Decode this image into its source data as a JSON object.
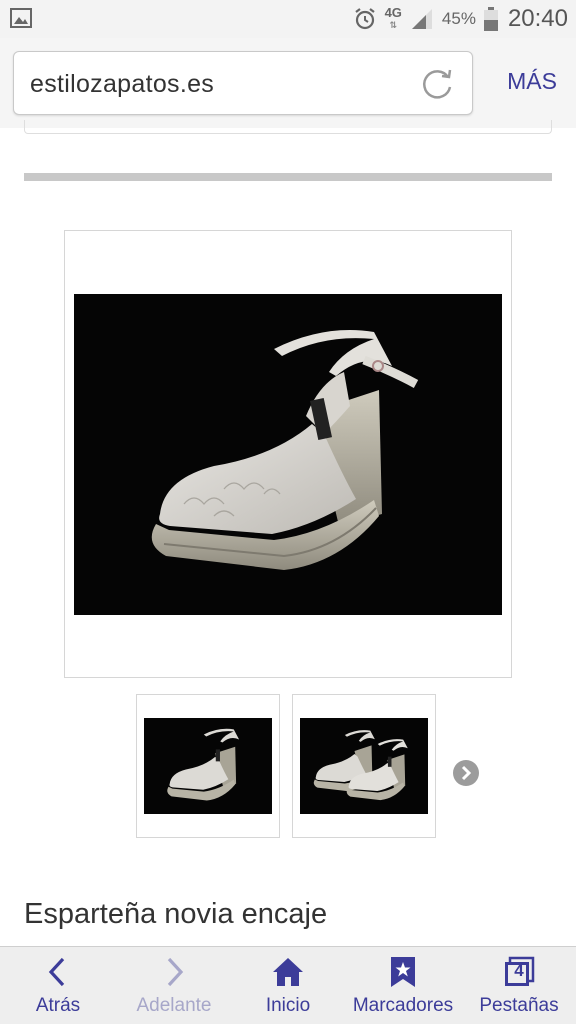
{
  "status_bar": {
    "network": "4G",
    "battery_percent": "45%",
    "time": "20:40",
    "icons": [
      "image-icon",
      "alarm-icon",
      "signal-icon",
      "battery-icon"
    ]
  },
  "browser": {
    "url": "estilozapatos.es",
    "more_label": "MÁS"
  },
  "product": {
    "title": "Esparteña novia encaje"
  },
  "bottom_nav": {
    "back_label": "Atrás",
    "forward_label": "Adelante",
    "home_label": "Inicio",
    "bookmarks_label": "Marcadores",
    "tabs_label": "Pestañas",
    "tabs_count": "4"
  },
  "colors": {
    "accent": "#3c3c99",
    "disabled": "#a7a7c9",
    "image_background": "#050505"
  }
}
